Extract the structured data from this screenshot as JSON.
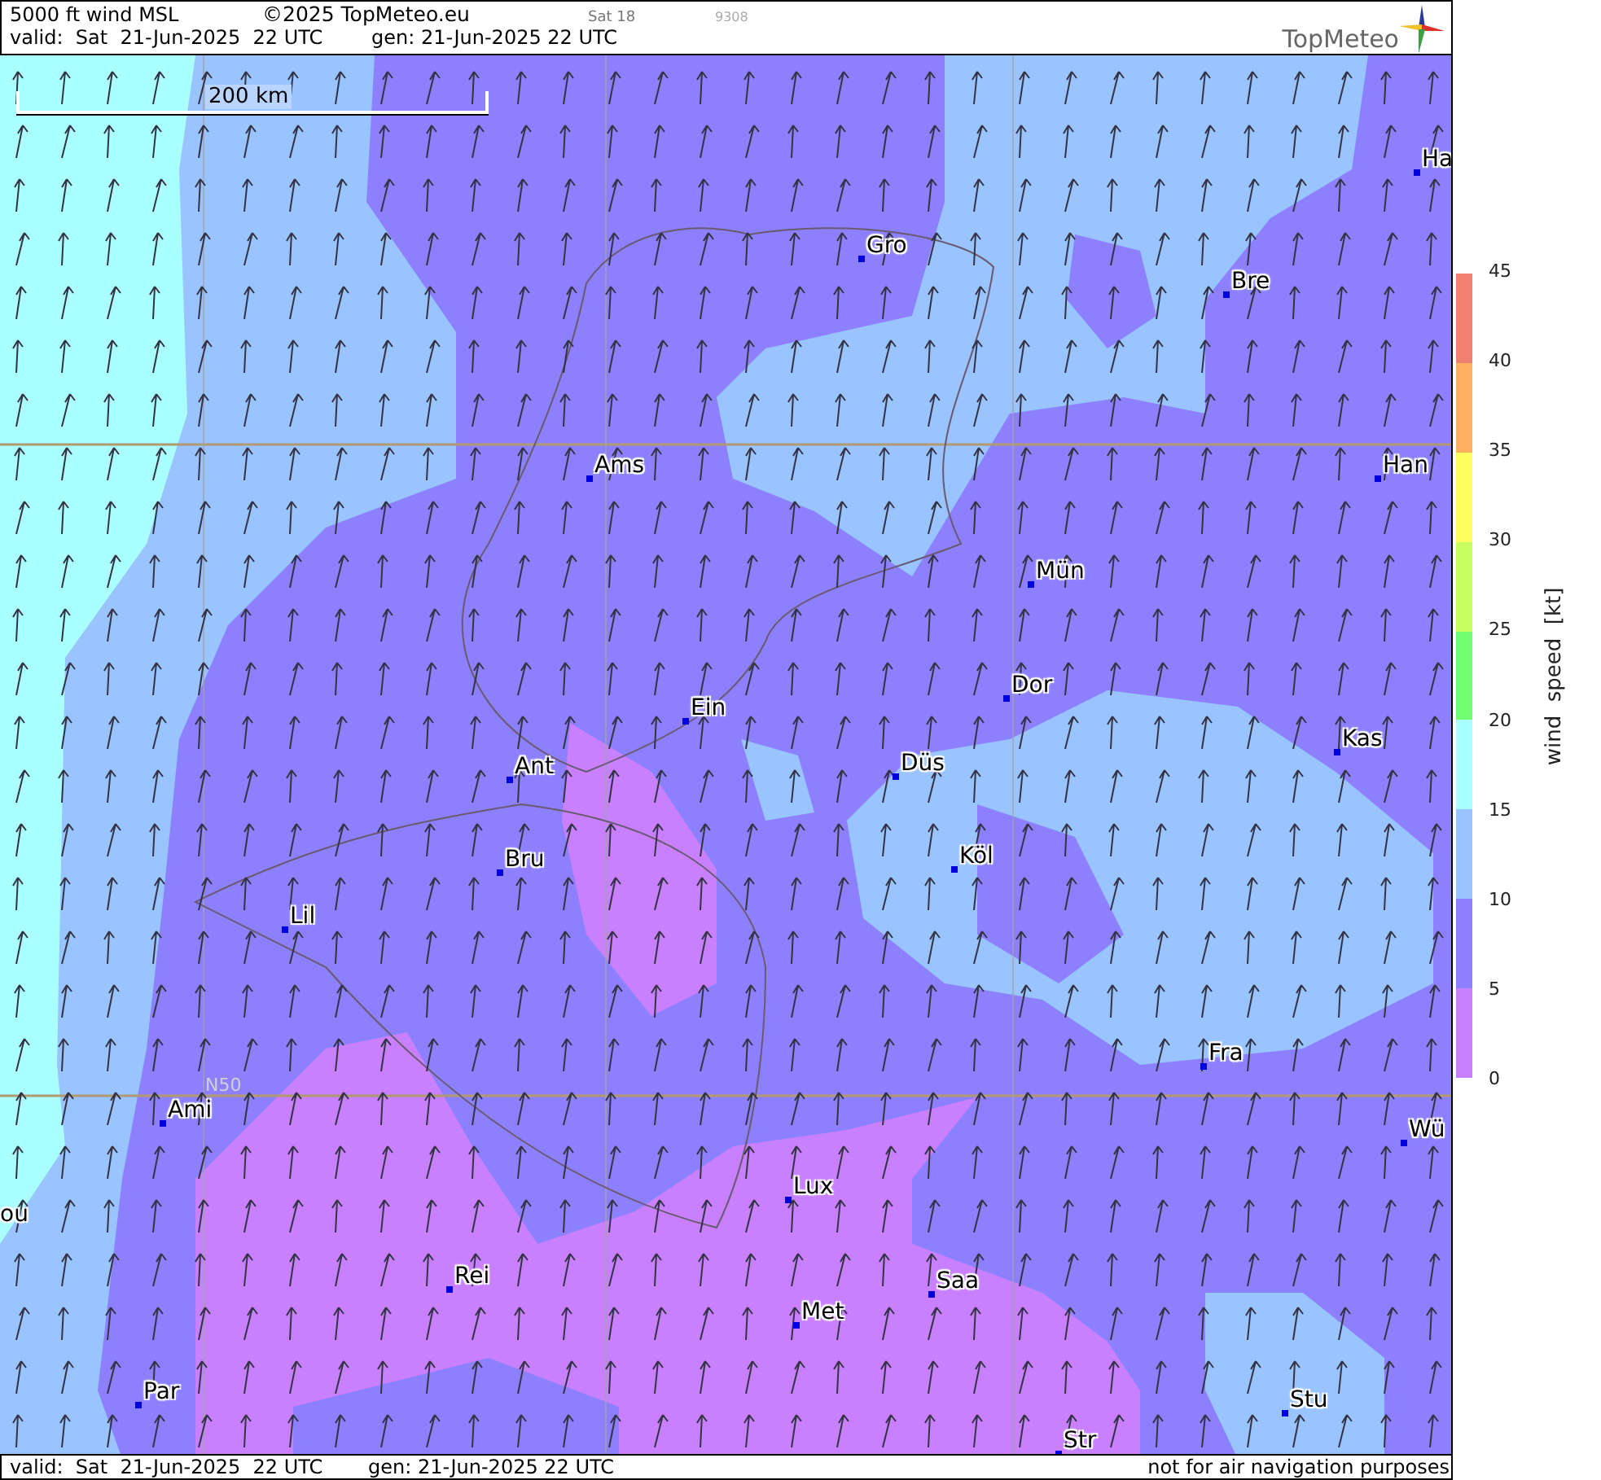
{
  "header": {
    "title": "5000 ft wind MSL",
    "copyright": "©2025 TopMeteo.eu",
    "run": "Sat 18",
    "code": "9308",
    "valid": "valid:  Sat  21-Jun-2025  22 UTC",
    "generated": "gen: 21-Jun-2025 22 UTC",
    "logo": "TopMeteo"
  },
  "map": {
    "scale": "200 km",
    "latitude_label": "N50",
    "cities": [
      {
        "name": "Ha"
      },
      {
        "name": "Gro"
      },
      {
        "name": "Bre"
      },
      {
        "name": "Ams"
      },
      {
        "name": "Han"
      },
      {
        "name": "Mün"
      },
      {
        "name": "Dor"
      },
      {
        "name": "Ein"
      },
      {
        "name": "Kas"
      },
      {
        "name": "Düs"
      },
      {
        "name": "Ant"
      },
      {
        "name": "Köl"
      },
      {
        "name": "Bru"
      },
      {
        "name": "Lil"
      },
      {
        "name": "Fra"
      },
      {
        "name": "Ami"
      },
      {
        "name": "Wü"
      },
      {
        "name": "Lux"
      },
      {
        "name": "ou"
      },
      {
        "name": "Rei"
      },
      {
        "name": "Saa"
      },
      {
        "name": "Met"
      },
      {
        "name": "Par"
      },
      {
        "name": "Stu"
      },
      {
        "name": "Str"
      }
    ]
  },
  "legend": {
    "title": "wind  speed  [kt]",
    "bins": [
      {
        "color": "#f08070"
      },
      {
        "color": "#ffb060"
      },
      {
        "color": "#ffff60"
      },
      {
        "color": "#c8ff60"
      },
      {
        "color": "#70ff70"
      },
      {
        "color": "#aaffff"
      },
      {
        "color": "#99c4ff"
      },
      {
        "color": "#8c80ff"
      },
      {
        "color": "#c880ff"
      }
    ],
    "ticks": [
      "45",
      "40",
      "35",
      "30",
      "25",
      "20",
      "15",
      "10",
      "5",
      "0"
    ]
  },
  "footer": {
    "valid": "valid:  Sat  21-Jun-2025  22 UTC",
    "generated": "gen: 21-Jun-2025 22 UTC",
    "disclaimer": "not for air navigation purposes"
  }
}
